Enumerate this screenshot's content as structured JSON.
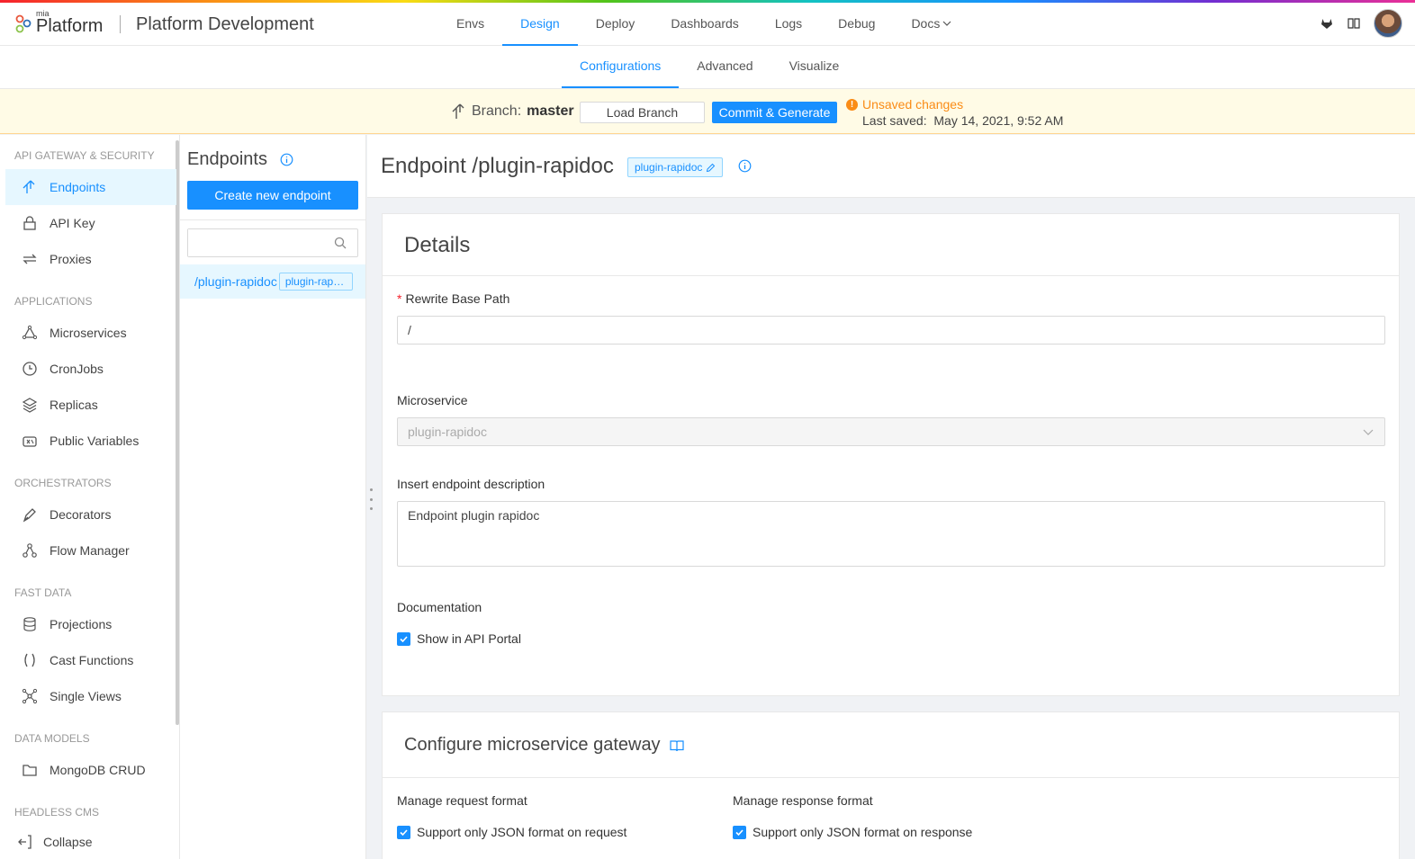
{
  "app": {
    "logo_small": "mia",
    "logo_main": "Platform",
    "project_title": "Platform Development"
  },
  "main_nav": [
    {
      "label": "Envs",
      "active": false
    },
    {
      "label": "Design",
      "active": true
    },
    {
      "label": "Deploy",
      "active": false
    },
    {
      "label": "Dashboards",
      "active": false
    },
    {
      "label": "Logs",
      "active": false
    },
    {
      "label": "Debug",
      "active": false
    },
    {
      "label": "Docs",
      "active": false
    }
  ],
  "sub_nav": [
    {
      "label": "Configurations",
      "active": true
    },
    {
      "label": "Advanced",
      "active": false
    },
    {
      "label": "Visualize",
      "active": false
    }
  ],
  "branch_bar": {
    "branch_prefix": "Branch:",
    "branch_name": "master",
    "load_button": "Load Branch",
    "commit_button": "Commit & Generate",
    "unsaved_text": "Unsaved changes",
    "last_saved_label": "Last saved:",
    "last_saved_value": "May 14, 2021, 9:52 AM"
  },
  "sidebar": {
    "sections": [
      {
        "title": "API GATEWAY & SECURITY",
        "items": [
          "Endpoints",
          "API Key",
          "Proxies"
        ]
      },
      {
        "title": "APPLICATIONS",
        "items": [
          "Microservices",
          "CronJobs",
          "Replicas",
          "Public Variables"
        ]
      },
      {
        "title": "ORCHESTRATORS",
        "items": [
          "Decorators",
          "Flow Manager"
        ]
      },
      {
        "title": "FAST DATA",
        "items": [
          "Projections",
          "Cast Functions",
          "Single Views"
        ]
      },
      {
        "title": "DATA MODELS",
        "items": [
          "MongoDB CRUD"
        ]
      },
      {
        "title": "HEADLESS CMS",
        "items": []
      }
    ],
    "collapse_label": "Collapse"
  },
  "endpoints_panel": {
    "title": "Endpoints",
    "create_button": "Create new endpoint",
    "search_placeholder": "",
    "rows": [
      {
        "path": "/plugin-rapidoc",
        "tag": "plugin-rapidoc"
      }
    ]
  },
  "detail": {
    "title": "Endpoint /plugin-rapidoc",
    "tag": "plugin-rapidoc",
    "details_card": {
      "title": "Details",
      "rewrite_label": "Rewrite Base Path",
      "rewrite_value": "/",
      "microservice_label": "Microservice",
      "microservice_value": "plugin-rapidoc",
      "description_label": "Insert endpoint description",
      "description_value": "Endpoint plugin rapidoc",
      "documentation_label": "Documentation",
      "show_in_portal_label": "Show in API Portal"
    },
    "gateway_card": {
      "title": "Configure microservice gateway",
      "request_label": "Manage request format",
      "request_checkbox": "Support only JSON format on request",
      "response_label": "Manage response format",
      "response_checkbox": "Support only JSON format on response"
    }
  },
  "colors": {
    "accent": "#1890ff",
    "warning": "#fa8c16",
    "active_bg": "#e6f7ff",
    "branch_bar_bg": "#fffbe6"
  }
}
